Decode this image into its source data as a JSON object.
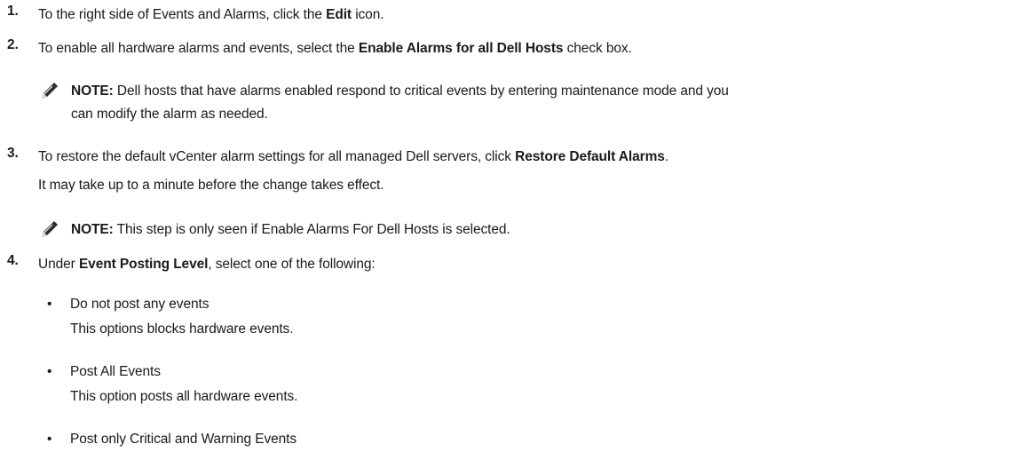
{
  "steps": [
    {
      "number": "1.",
      "parts": [
        "To the right side of Events and Alarms, click the ",
        "Edit",
        " icon."
      ]
    },
    {
      "number": "2.",
      "parts": [
        "To enable all hardware alarms and events, select the ",
        "Enable Alarms for all Dell Hosts",
        " check box."
      ]
    },
    {
      "number": "3.",
      "parts": [
        "To restore the default vCenter alarm settings for all managed Dell servers, click ",
        "Restore Default Alarms",
        "."
      ],
      "continuation": "It may take up to a minute before the change takes effect."
    },
    {
      "number": "4.",
      "parts": [
        "Under ",
        "Event Posting Level",
        ", select one of the following:"
      ]
    }
  ],
  "notes": [
    {
      "label": "NOTE:",
      "line1": " Dell hosts that have alarms enabled respond to critical events by entering maintenance mode and you",
      "line2": "can modify the alarm as needed."
    },
    {
      "label": "NOTE:",
      "line1": " This step is only seen if Enable Alarms For Dell Hosts is selected."
    }
  ],
  "bullets": [
    {
      "title": "Do not post any events",
      "desc": "This options blocks hardware events."
    },
    {
      "title": "Post All Events",
      "desc": "This option posts all hardware events."
    },
    {
      "title": "Post only Critical and Warning Events",
      "desc": ""
    }
  ],
  "bullet_glyph": "•",
  "icon": "note-pencil-icon",
  "colors": {
    "text": "#1a1a1a",
    "background": "#ffffff"
  }
}
